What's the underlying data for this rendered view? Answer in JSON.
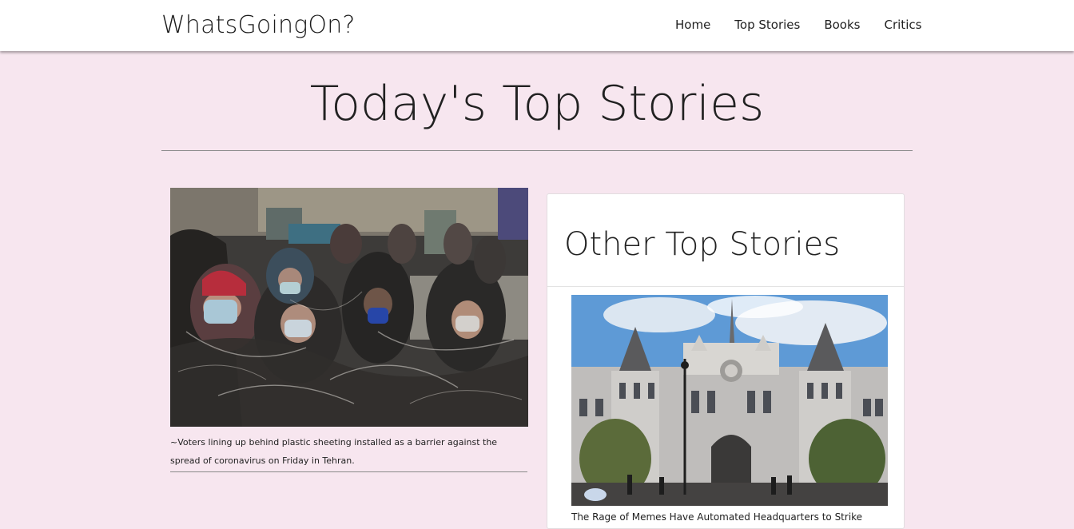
{
  "navbar": {
    "brand": "WhatsGoingOn?",
    "links": [
      "Home",
      "Top Stories",
      "Books",
      "Critics"
    ]
  },
  "page": {
    "title": "Today's Top Stories"
  },
  "main_story": {
    "caption": "~Voters lining up behind plastic sheeting installed as a barrier against the spread of coronavirus on Friday in Tehran."
  },
  "side_card": {
    "title": "Other Top Stories",
    "caption": "The Rage of Memes Have Automated Headquarters to Strike"
  }
}
